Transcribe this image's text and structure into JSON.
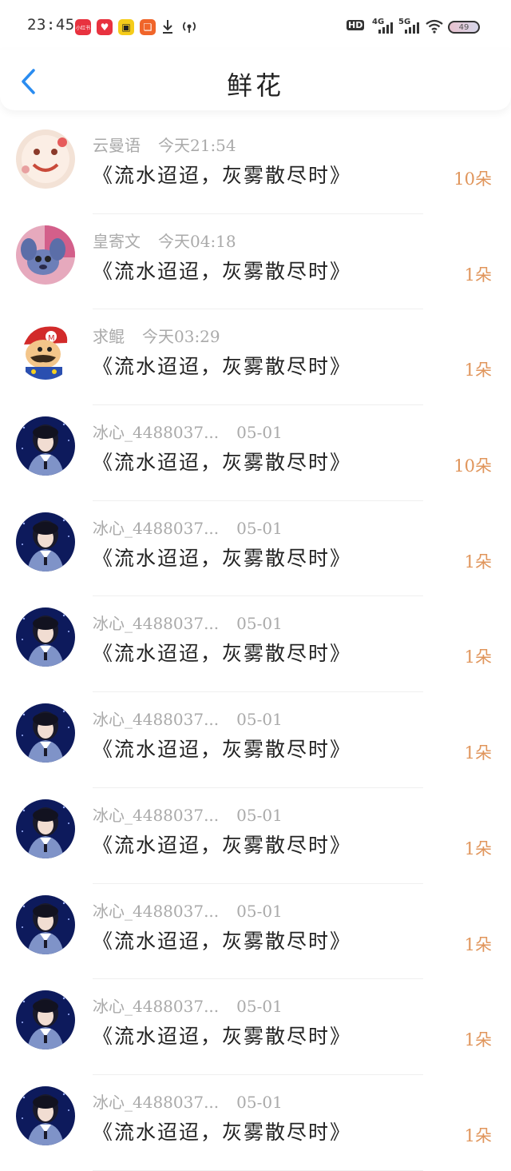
{
  "status_bar": {
    "time": "23:45",
    "apps": [
      {
        "name": "xiaohongshu-icon",
        "label": "小红书",
        "color": "#e8323f"
      },
      {
        "name": "heart-app-icon",
        "label": "♥",
        "color": "#e8323f"
      },
      {
        "name": "tv-app-icon",
        "label": "▣",
        "color": "#f5cc1a"
      },
      {
        "name": "grid-app-icon",
        "label": "❏",
        "color": "#f0652a"
      }
    ],
    "hd": "HD",
    "net1": "4G",
    "net2": "5G",
    "battery": "49"
  },
  "header": {
    "title": "鲜花"
  },
  "items": [
    {
      "user": "云曼语",
      "time": "今天21:54",
      "song": "《流水迢迢，灰雾散尽时》",
      "count": "10朵",
      "avatar": "cake"
    },
    {
      "user": "皇寄文",
      "time": "今天04:18",
      "song": "《流水迢迢，灰雾散尽时》",
      "count": "1朵",
      "avatar": "stitch"
    },
    {
      "user": "求鲲",
      "time": "今天03:29",
      "song": "《流水迢迢，灰雾散尽时》",
      "count": "1朵",
      "avatar": "mario"
    },
    {
      "user": "冰心_4488037...",
      "time": "05-01",
      "song": "《流水迢迢，灰雾散尽时》",
      "count": "10朵",
      "avatar": "girl"
    },
    {
      "user": "冰心_4488037...",
      "time": "05-01",
      "song": "《流水迢迢，灰雾散尽时》",
      "count": "1朵",
      "avatar": "girl"
    },
    {
      "user": "冰心_4488037...",
      "time": "05-01",
      "song": "《流水迢迢，灰雾散尽时》",
      "count": "1朵",
      "avatar": "girl"
    },
    {
      "user": "冰心_4488037...",
      "time": "05-01",
      "song": "《流水迢迢，灰雾散尽时》",
      "count": "1朵",
      "avatar": "girl"
    },
    {
      "user": "冰心_4488037...",
      "time": "05-01",
      "song": "《流水迢迢，灰雾散尽时》",
      "count": "1朵",
      "avatar": "girl"
    },
    {
      "user": "冰心_4488037...",
      "time": "05-01",
      "song": "《流水迢迢，灰雾散尽时》",
      "count": "1朵",
      "avatar": "girl"
    },
    {
      "user": "冰心_4488037...",
      "time": "05-01",
      "song": "《流水迢迢，灰雾散尽时》",
      "count": "1朵",
      "avatar": "girl"
    },
    {
      "user": "冰心_4488037...",
      "time": "05-01",
      "song": "《流水迢迢，灰雾散尽时》",
      "count": "1朵",
      "avatar": "girl"
    }
  ],
  "colors": {
    "accent": "#e0955b",
    "back": "#2a8cf0"
  }
}
